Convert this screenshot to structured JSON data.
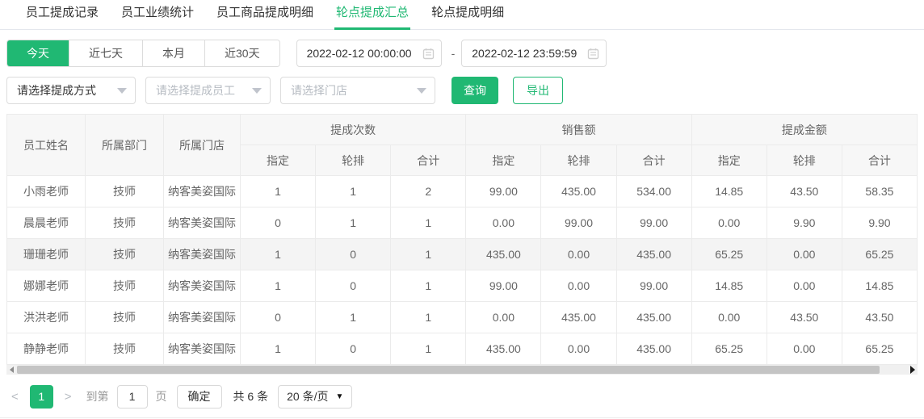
{
  "colors": {
    "accent": "#20b873"
  },
  "tabs": {
    "active_index": 3,
    "items": [
      {
        "label": "员工提成记录"
      },
      {
        "label": "员工业绩统计"
      },
      {
        "label": "员工商品提成明细"
      },
      {
        "label": "轮点提成汇总"
      },
      {
        "label": "轮点提成明细"
      }
    ]
  },
  "filters": {
    "quick_ranges": {
      "active_index": 0,
      "items": [
        "今天",
        "近七天",
        "本月",
        "近30天"
      ]
    },
    "date_from": "2022-02-12 00:00:00",
    "date_to": "2022-02-12 23:59:59",
    "date_separator": "-",
    "selects": [
      {
        "placeholder": "请选择提成方式",
        "filled": true
      },
      {
        "placeholder": "请选择提成员工",
        "filled": false
      },
      {
        "placeholder": "请选择门店",
        "filled": false
      }
    ],
    "search_label": "查询",
    "export_label": "导出"
  },
  "table": {
    "fixed_columns": [
      "员工姓名",
      "所属部门",
      "所属门店"
    ],
    "groups": [
      {
        "label": "提成次数",
        "children": [
          "指定",
          "轮排",
          "合计"
        ]
      },
      {
        "label": "销售额",
        "children": [
          "指定",
          "轮排",
          "合计"
        ]
      },
      {
        "label": "提成金额",
        "children": [
          "指定",
          "轮排",
          "合计"
        ]
      }
    ],
    "highlight_row_index": 2,
    "rows": [
      [
        "小雨老师",
        "技师",
        "纳客美姿国际",
        "1",
        "1",
        "2",
        "99.00",
        "435.00",
        "534.00",
        "14.85",
        "43.50",
        "58.35"
      ],
      [
        "晨晨老师",
        "技师",
        "纳客美姿国际",
        "0",
        "1",
        "1",
        "0.00",
        "99.00",
        "99.00",
        "0.00",
        "9.90",
        "9.90"
      ],
      [
        "珊珊老师",
        "技师",
        "纳客美姿国际",
        "1",
        "0",
        "1",
        "435.00",
        "0.00",
        "435.00",
        "65.25",
        "0.00",
        "65.25"
      ],
      [
        "娜娜老师",
        "技师",
        "纳客美姿国际",
        "1",
        "0",
        "1",
        "99.00",
        "0.00",
        "99.00",
        "14.85",
        "0.00",
        "14.85"
      ],
      [
        "洪洪老师",
        "技师",
        "纳客美姿国际",
        "0",
        "1",
        "1",
        "0.00",
        "435.00",
        "435.00",
        "0.00",
        "43.50",
        "43.50"
      ],
      [
        "静静老师",
        "技师",
        "纳客美姿国际",
        "1",
        "0",
        "1",
        "435.00",
        "0.00",
        "435.00",
        "65.25",
        "0.00",
        "65.25"
      ]
    ]
  },
  "pagination": {
    "prev_icon": "<",
    "next_icon": ">",
    "current_page": "1",
    "goto_label": "到第",
    "goto_value": "1",
    "page_unit_label": "页",
    "confirm_label": "确定",
    "total_label": "共 6 条",
    "page_size_label": "20 条/页",
    "page_size_caret": "▼"
  }
}
